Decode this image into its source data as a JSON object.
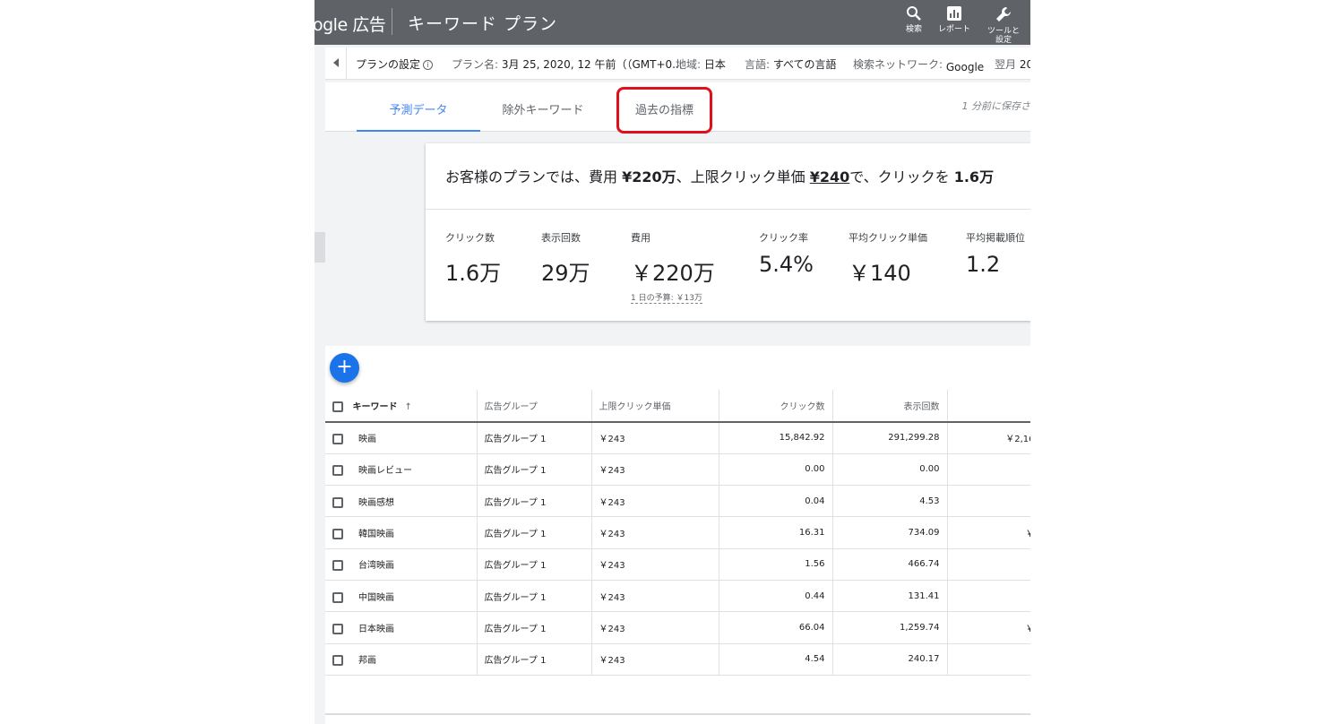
{
  "header": {
    "brand": "ogle 広告",
    "title": "キーワード プラン",
    "buttons": [
      {
        "label": "検索",
        "icon": "search-icon"
      },
      {
        "label": "レポート",
        "icon": "report-icon"
      },
      {
        "label": "ツールと\n設定",
        "icon": "wrench-icon"
      }
    ]
  },
  "settings": {
    "plan_settings": "プランの設定",
    "plan_name_label": "プラン名:",
    "plan_name_value": "3月 25, 2020, 12 午前（（GMT+0...",
    "region_label": "地域:",
    "region_value": "日本",
    "language_label": "言語:",
    "language_value": "すべての言語",
    "network_label": "検索ネットワーク:",
    "network_value": "Google",
    "month_label": "翌月",
    "month_value": "20"
  },
  "tabs": [
    {
      "label": "予測データ",
      "active": true
    },
    {
      "label": "除外キーワード",
      "active": false
    },
    {
      "label": "過去の指標",
      "active": false,
      "highlighted": true
    }
  ],
  "saved_status": "1 分前に保存さ",
  "summary": {
    "prefix": "お客様のプランでは、費用 ",
    "cost": "¥220万",
    "mid1": "、上限クリック単価 ",
    "max_cpc": "¥240",
    "mid2": "で、クリックを ",
    "clicks": "1.6万"
  },
  "metrics": [
    {
      "label": "クリック数",
      "value": "1.6万"
    },
    {
      "label": "表示回数",
      "value": "29万"
    },
    {
      "label": "費用",
      "value": "￥220万",
      "sub": "1 日の予算: ￥13万"
    },
    {
      "label": "クリック率",
      "value": "5.4%"
    },
    {
      "label": "平均クリック単価",
      "value": "￥140"
    },
    {
      "label": "平均掲載順位",
      "value": "1.2"
    }
  ],
  "add_button": "+",
  "table": {
    "columns": [
      "キーワード",
      "広告グループ",
      "上限クリック単価",
      "クリック数",
      "表示回数",
      ""
    ],
    "rows": [
      {
        "keyword": "映画",
        "group": "広告グループ 1",
        "cpc": "￥243",
        "clicks": "15,842.92",
        "impressions": "291,299.28",
        "cost": "￥2,16"
      },
      {
        "keyword": "映画レビュー",
        "group": "広告グループ 1",
        "cpc": "￥243",
        "clicks": "0.00",
        "impressions": "0.00",
        "cost": ""
      },
      {
        "keyword": "映画感想",
        "group": "広告グループ 1",
        "cpc": "￥243",
        "clicks": "0.04",
        "impressions": "4.53",
        "cost": ""
      },
      {
        "keyword": "韓国映画",
        "group": "広告グループ 1",
        "cpc": "￥243",
        "clicks": "16.31",
        "impressions": "734.09",
        "cost": "￥"
      },
      {
        "keyword": "台湾映画",
        "group": "広告グループ 1",
        "cpc": "￥243",
        "clicks": "1.56",
        "impressions": "466.74",
        "cost": ""
      },
      {
        "keyword": "中国映画",
        "group": "広告グループ 1",
        "cpc": "￥243",
        "clicks": "0.44",
        "impressions": "131.41",
        "cost": ""
      },
      {
        "keyword": "日本映画",
        "group": "広告グループ 1",
        "cpc": "￥243",
        "clicks": "66.04",
        "impressions": "1,259.74",
        "cost": "￥"
      },
      {
        "keyword": "邦画",
        "group": "広告グループ 1",
        "cpc": "￥243",
        "clicks": "4.54",
        "impressions": "240.17",
        "cost": ""
      }
    ]
  },
  "colors": {
    "header_bg": "#5f6368",
    "accent_blue": "#4285f4",
    "fab_blue": "#1a73e8",
    "highlight_red": "#e0101a"
  }
}
